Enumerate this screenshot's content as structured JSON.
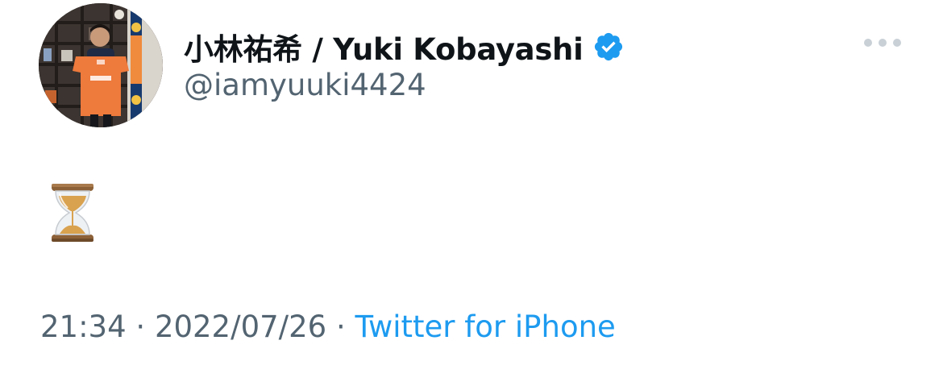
{
  "tweet": {
    "author": {
      "display_name": "小林祐希 / Yuki Kobayashi",
      "handle": "@iamyuuki4424",
      "verified": true,
      "avatar_icon": "profile-photo"
    },
    "more_icon": "ellipsis-icon",
    "content": {
      "emoji_name": "hourglass-icon",
      "emoji": "⏳"
    },
    "meta": {
      "time": "21:34",
      "separator1": " · ",
      "date": "2022/07/26",
      "separator2": " · ",
      "source": "Twitter for iPhone"
    },
    "colors": {
      "verified_badge": "#1d9bf0",
      "link": "#1d9bf0",
      "secondary_text": "#536471",
      "primary_text": "#0f1419"
    }
  }
}
